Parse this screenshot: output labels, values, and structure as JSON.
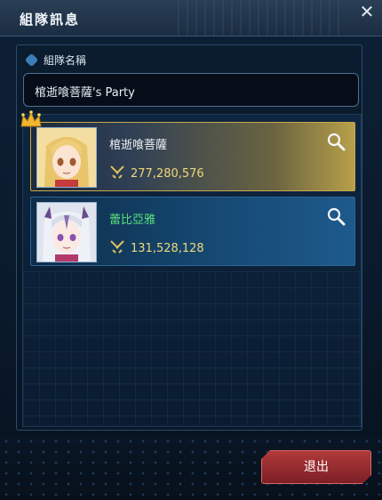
{
  "window": {
    "title": "組隊訊息"
  },
  "close": {
    "glyph": "✕"
  },
  "party_section": {
    "label": "組隊名稱",
    "party_name": "棺逝喰菩薩's Party"
  },
  "members": [
    {
      "name": "棺逝喰菩薩",
      "power": "277,280,576",
      "role": "leader",
      "name_color": "#f2f4f8"
    },
    {
      "name": "蕾比亞雅",
      "power": "131,528,128",
      "role": "member",
      "name_color": "#58e07a"
    }
  ],
  "buttons": {
    "exit_label": "退出"
  },
  "colors": {
    "leader_accent": "#c9a84a",
    "member_name": "#58e07a",
    "power_text": "#f0d77a",
    "exit_button": "#a0303a"
  },
  "icons": {
    "close": "close-icon",
    "search": "search-icon",
    "crown": "crown-icon",
    "power": "crossed-swords-icon"
  }
}
